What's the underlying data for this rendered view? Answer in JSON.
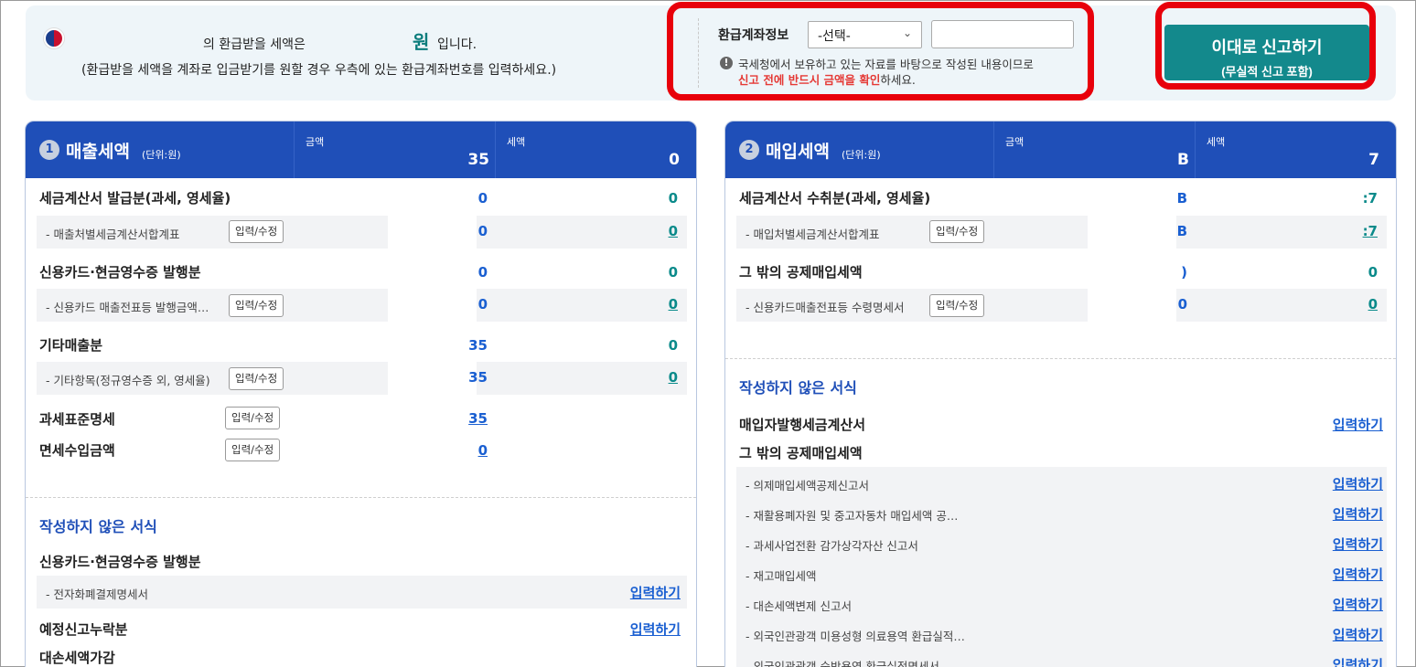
{
  "topbar": {
    "refund_text": "의 환급받을 세액은",
    "won": "원",
    "won_suffix": "입니다.",
    "refund_hint": "(환급받을 세액을 계좌로 입금받기를 원할 경우 우측에 있는 환급계좌번호를 입력하세요.)",
    "account_label": "환급계좌정보",
    "account_select_value": "-선택-",
    "account_input_value": "",
    "warning_line1": "국세청에서 보유하고 있는 자료를 바탕으로 작성된 내용이므로",
    "warning_red": "신고 전에 반드시 금액을 확인",
    "warning_tail": "하세요.",
    "submit_main": "이대로 신고하기",
    "submit_sub": "(무실적 신고 포함)"
  },
  "left": {
    "num": "1",
    "title": "매출세액",
    "unit": "(단위:원)",
    "amount_label": "금액",
    "tax_label": "세액",
    "amount_total": "35",
    "tax_total": "0",
    "rows": [
      {
        "label": "세금계산서 발급분(과세, 영세율)",
        "amount": "0",
        "tax": "0"
      },
      {
        "label": "- 매출처별세금계산서합계표",
        "btn": "입력/수정",
        "amount": "0",
        "tax": "0"
      },
      {
        "label": "신용카드·현금영수증 발행분",
        "amount": "0",
        "tax": "0"
      },
      {
        "label": "- 신용카드 매출전표등 발행금액…",
        "btn": "입력/수정",
        "amount": "0",
        "tax": "0"
      },
      {
        "label": "기타매출분",
        "amount": "35",
        "tax": "0"
      },
      {
        "label": "- 기타항목(정규영수증 외, 영세율)",
        "btn": "입력/수정",
        "amount": "35",
        "tax": "0"
      },
      {
        "label": "과세표준명세",
        "btn": "입력/수정",
        "amount": "35"
      },
      {
        "label": "면세수입금액",
        "btn": "입력/수정",
        "amount": "0"
      }
    ],
    "unwritten_title": "작성하지 않은 서식",
    "unwritten": [
      {
        "label": "신용카드·현금영수증 발행분"
      },
      {
        "label": "- 전자화폐결제명세서",
        "link": "입력하기"
      },
      {
        "label": "예정신고누락분",
        "link": "입력하기"
      },
      {
        "label": "대손세액가감"
      }
    ]
  },
  "right": {
    "num": "2",
    "title": "매입세액",
    "unit": "(단위:원)",
    "amount_label": "금액",
    "tax_label": "세액",
    "amount_total": "B",
    "tax_total": "7",
    "rows": [
      {
        "label": "세금계산서 수취분(과세, 영세율)",
        "amount": "B",
        "tax": ":7"
      },
      {
        "label": "- 매입처별세금계산서합계표",
        "btn": "입력/수정",
        "amount": "B",
        "tax": ":7"
      },
      {
        "label": "그 밖의 공제매입세액",
        "amount": ")",
        "tax": "0"
      },
      {
        "label": "- 신용카드매출전표등 수령명세서",
        "btn": "입력/수정",
        "amount": "0",
        "tax": "0"
      }
    ],
    "unwritten_title": "작성하지 않은 서식",
    "unwritten": [
      {
        "label": "매입자발행세금계산서",
        "link": "입력하기"
      },
      {
        "label": "그 밖의 공제매입세액"
      },
      {
        "label": "- 의제매입세액공제신고서",
        "link": "입력하기"
      },
      {
        "label": "- 재활용폐자원 및 중고자동차 매입세액 공…",
        "link": "입력하기"
      },
      {
        "label": "- 과세사업전환 감가상각자산 신고서",
        "link": "입력하기"
      },
      {
        "label": "- 재고매입세액",
        "link": "입력하기"
      },
      {
        "label": "- 대손세액변제 신고서",
        "link": "입력하기"
      },
      {
        "label": "- 외국인관광객 미용성형 의료용역 환급실적…",
        "link": "입력하기"
      },
      {
        "label": "- 외국인관광객 숙박용역 환급실적명세서",
        "link": "입력하기"
      }
    ]
  }
}
